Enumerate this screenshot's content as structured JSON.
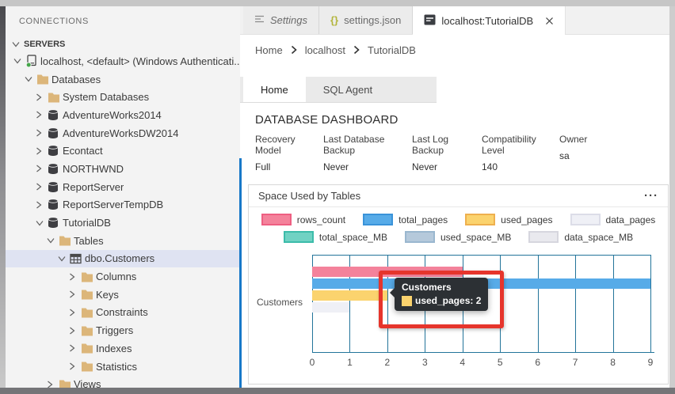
{
  "sidebar": {
    "panel_title": "CONNECTIONS",
    "section": {
      "label": "SERVERS"
    },
    "tree": [
      {
        "label": "localhost, <default> (Windows Authenticati...",
        "level": 1,
        "state": "expanded",
        "icon": "server",
        "selected": false
      },
      {
        "label": "Databases",
        "level": 2,
        "state": "expanded",
        "icon": "folder",
        "selected": false
      },
      {
        "label": "System Databases",
        "level": 3,
        "state": "collapsed",
        "icon": "folder",
        "selected": false
      },
      {
        "label": "AdventureWorks2014",
        "level": 3,
        "state": "collapsed",
        "icon": "database",
        "selected": false
      },
      {
        "label": "AdventureWorksDW2014",
        "level": 3,
        "state": "collapsed",
        "icon": "database",
        "selected": false
      },
      {
        "label": "Econtact",
        "level": 3,
        "state": "collapsed",
        "icon": "database",
        "selected": false
      },
      {
        "label": "NORTHWND",
        "level": 3,
        "state": "collapsed",
        "icon": "database",
        "selected": false
      },
      {
        "label": "ReportServer",
        "level": 3,
        "state": "collapsed",
        "icon": "database",
        "selected": false
      },
      {
        "label": "ReportServerTempDB",
        "level": 3,
        "state": "collapsed",
        "icon": "database",
        "selected": false
      },
      {
        "label": "TutorialDB",
        "level": 3,
        "state": "expanded",
        "icon": "database",
        "selected": false
      },
      {
        "label": "Tables",
        "level": 4,
        "state": "expanded",
        "icon": "folder",
        "selected": false
      },
      {
        "label": "dbo.Customers",
        "level": 5,
        "state": "expanded",
        "icon": "table",
        "selected": true
      },
      {
        "label": "Columns",
        "level": 6,
        "state": "collapsed",
        "icon": "folder",
        "selected": false
      },
      {
        "label": "Keys",
        "level": 6,
        "state": "collapsed",
        "icon": "folder",
        "selected": false
      },
      {
        "label": "Constraints",
        "level": 6,
        "state": "collapsed",
        "icon": "folder",
        "selected": false
      },
      {
        "label": "Triggers",
        "level": 6,
        "state": "collapsed",
        "icon": "folder",
        "selected": false
      },
      {
        "label": "Indexes",
        "level": 6,
        "state": "collapsed",
        "icon": "folder",
        "selected": false
      },
      {
        "label": "Statistics",
        "level": 6,
        "state": "collapsed",
        "icon": "folder",
        "selected": false
      },
      {
        "label": "Views",
        "level": 4,
        "state": "collapsed",
        "icon": "folder",
        "selected": false
      }
    ]
  },
  "editor_tabs": [
    {
      "label": "Settings",
      "icon": "settings-list-icon",
      "italic": true,
      "active": false,
      "closable": false
    },
    {
      "label": "settings.json",
      "icon": "braces-icon",
      "italic": false,
      "active": false,
      "closable": false
    },
    {
      "label": "localhost:TutorialDB",
      "icon": "dashboard-icon",
      "italic": false,
      "active": true,
      "closable": true
    }
  ],
  "breadcrumb": {
    "items": [
      "Home",
      "localhost",
      "TutorialDB"
    ]
  },
  "page_tabs": [
    {
      "label": "Home",
      "active": true
    },
    {
      "label": "SQL Agent",
      "active": false
    }
  ],
  "dashboard": {
    "title": "DATABASE DASHBOARD",
    "fields": [
      {
        "label": "Recovery Model",
        "value": "Full"
      },
      {
        "label": "Last Database Backup",
        "value": "Never"
      },
      {
        "label": "Last Log Backup",
        "value": "Never"
      },
      {
        "label": "Compatibility Level",
        "value": "140"
      },
      {
        "label": "Owner",
        "value": "sa"
      }
    ]
  },
  "panel": {
    "title": "Space Used by Tables",
    "more_icon": "···"
  },
  "chart_data": {
    "type": "bar",
    "orientation": "horizontal",
    "title": "Space Used by Tables",
    "categories": [
      "Customers"
    ],
    "series": [
      {
        "name": "rows_count",
        "value": 4,
        "fill": "#f4829b",
        "border": "#ee5f82"
      },
      {
        "name": "total_pages",
        "value": 9,
        "fill": "#57abe8",
        "border": "#3a93d9"
      },
      {
        "name": "used_pages",
        "value": 2,
        "fill": "#fbd36e",
        "border": "#eeb04e"
      },
      {
        "name": "data_pages",
        "value": 1,
        "fill": "#eff0f6",
        "border": "#dcdde8"
      },
      {
        "name": "total_space_MB",
        "value": 0,
        "fill": "#70d2c3",
        "border": "#3cbcaa"
      },
      {
        "name": "used_space_MB",
        "value": 0,
        "fill": "#b5c9db",
        "border": "#9ab7cf"
      },
      {
        "name": "data_space_MB",
        "value": 0,
        "fill": "#e9e9ee",
        "border": "#d6d6de"
      }
    ],
    "xlim": [
      0,
      9
    ],
    "xticks": [
      "0",
      "1",
      "2",
      "3",
      "4",
      "5",
      "6",
      "7",
      "8",
      "9"
    ],
    "grid": true,
    "grid_color": "#23749a",
    "legend_position": "top",
    "tooltip": {
      "title": "Customers",
      "series": "used_pages",
      "value": "2",
      "text": "used_pages: 2"
    }
  },
  "annotation": {
    "type": "red-rectangle-highlight",
    "color": "#e6352c"
  }
}
